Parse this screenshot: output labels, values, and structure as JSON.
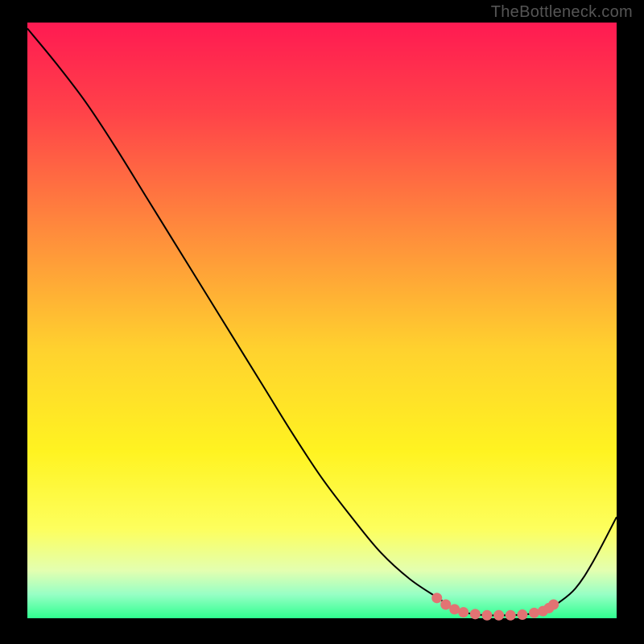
{
  "watermark": "TheBottleneck.com",
  "chart_data": {
    "type": "line",
    "title": "",
    "xlabel": "",
    "ylabel": "",
    "xlim": [
      0,
      100
    ],
    "ylim": [
      0,
      100
    ],
    "gradient_stops": [
      {
        "pos": 0.0,
        "color": "#ff1a52"
      },
      {
        "pos": 0.15,
        "color": "#ff4249"
      },
      {
        "pos": 0.35,
        "color": "#ff8b3c"
      },
      {
        "pos": 0.55,
        "color": "#ffd22e"
      },
      {
        "pos": 0.72,
        "color": "#fff321"
      },
      {
        "pos": 0.85,
        "color": "#fdff5d"
      },
      {
        "pos": 0.92,
        "color": "#e3ffb0"
      },
      {
        "pos": 0.96,
        "color": "#97ffc5"
      },
      {
        "pos": 1.0,
        "color": "#2fff8f"
      }
    ],
    "series": [
      {
        "name": "bottleneck-curve",
        "color": "#000000",
        "x": [
          0,
          5,
          10,
          15,
          20,
          25,
          30,
          35,
          40,
          45,
          50,
          55,
          60,
          65,
          70,
          72,
          75,
          78,
          80,
          82,
          85,
          88,
          90,
          93,
          96,
          100
        ],
        "y": [
          99,
          93,
          86.5,
          79,
          71,
          63,
          55,
          47,
          39,
          31,
          23.5,
          17,
          11,
          6.5,
          3.2,
          1.8,
          0.8,
          0.5,
          0.5,
          0.5,
          0.7,
          1.2,
          2.5,
          5,
          9.5,
          17
        ]
      }
    ],
    "highlighted": {
      "name": "optimal-range",
      "color": "#e27373",
      "points": [
        {
          "x": 69.5,
          "y": 3.4
        },
        {
          "x": 71,
          "y": 2.3
        },
        {
          "x": 72.5,
          "y": 1.5
        },
        {
          "x": 74,
          "y": 1.0
        },
        {
          "x": 76,
          "y": 0.7
        },
        {
          "x": 78,
          "y": 0.5
        },
        {
          "x": 80,
          "y": 0.5
        },
        {
          "x": 82,
          "y": 0.5
        },
        {
          "x": 84,
          "y": 0.6
        },
        {
          "x": 86,
          "y": 0.9
        },
        {
          "x": 87.5,
          "y": 1.2
        },
        {
          "x": 88.5,
          "y": 1.7
        },
        {
          "x": 89.3,
          "y": 2.3
        }
      ]
    }
  }
}
